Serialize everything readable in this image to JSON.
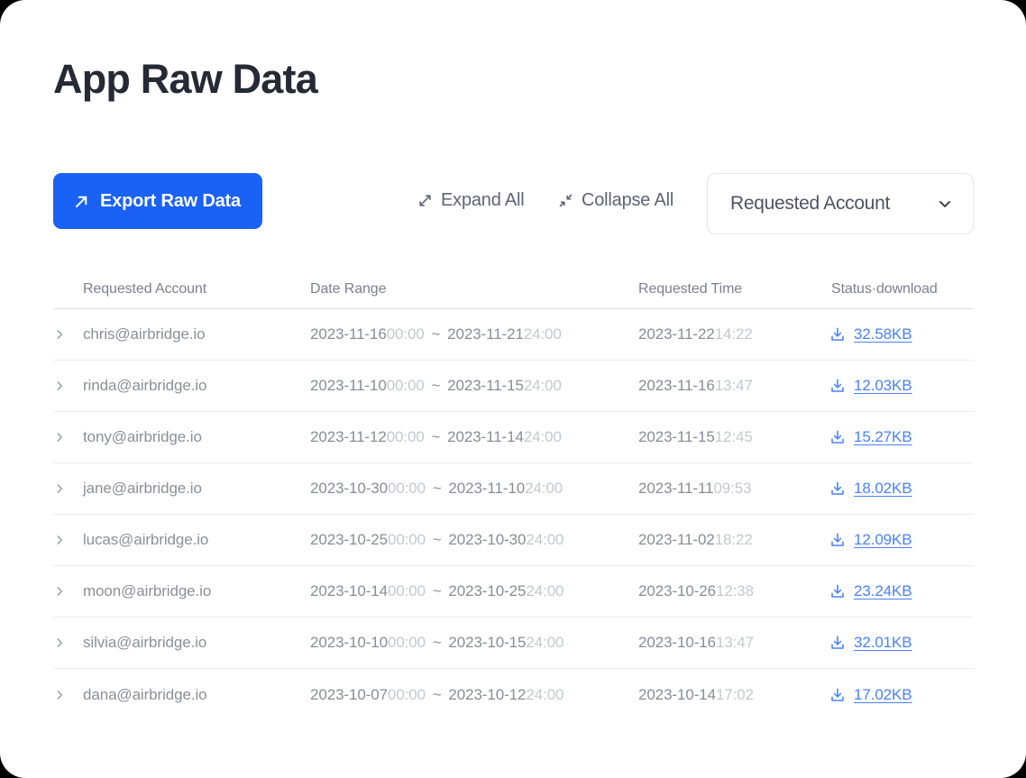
{
  "page": {
    "title": "App Raw Data"
  },
  "toolbar": {
    "export_label": "Export Raw Data",
    "export_icon": "arrow-up-right-icon",
    "expand_all_label": "Expand All",
    "expand_all_icon": "expand-diagonal-icon",
    "collapse_all_label": "Collapse All",
    "collapse_all_icon": "collapse-diagonal-icon",
    "filter_label": "Requested Account",
    "filter_icon": "chevron-down-icon"
  },
  "colors": {
    "accent_blue": "#1a62f5",
    "link_blue": "#4a82f7",
    "title_dark": "#252a34",
    "text_muted": "#8a9099",
    "text_faint": "#c3c8d1",
    "border": "#ebedf1",
    "card_bg": "#ffffff"
  },
  "table": {
    "columns": [
      {
        "key": "account",
        "label": "Requested Account"
      },
      {
        "key": "range",
        "label": "Date Range"
      },
      {
        "key": "time",
        "label": "Requested Time"
      },
      {
        "key": "status",
        "label": "Status·download"
      }
    ],
    "row_expand_icon": "chevron-right-icon",
    "download_icon": "download-icon",
    "range_separator": "~",
    "rows": [
      {
        "account": "chris@airbridge.io",
        "range_start_date": "2023-11-16",
        "range_start_time": "00:00",
        "range_end_date": "2023-11-21",
        "range_end_time": "24:00",
        "requested_date": "2023-11-22",
        "requested_time": "14:22",
        "download_size": "32.58KB"
      },
      {
        "account": "rinda@airbridge.io",
        "range_start_date": "2023-11-10",
        "range_start_time": "00:00",
        "range_end_date": "2023-11-15",
        "range_end_time": "24:00",
        "requested_date": "2023-11-16",
        "requested_time": "13:47",
        "download_size": "12.03KB"
      },
      {
        "account": "tony@airbridge.io",
        "range_start_date": "2023-11-12",
        "range_start_time": "00:00",
        "range_end_date": "2023-11-14",
        "range_end_time": "24:00",
        "requested_date": "2023-11-15",
        "requested_time": "12:45",
        "download_size": "15.27KB"
      },
      {
        "account": "jane@airbridge.io",
        "range_start_date": "2023-10-30",
        "range_start_time": "00:00",
        "range_end_date": "2023-11-10",
        "range_end_time": "24:00",
        "requested_date": "2023-11-11",
        "requested_time": "09:53",
        "download_size": "18.02KB"
      },
      {
        "account": "lucas@airbridge.io",
        "range_start_date": "2023-10-25",
        "range_start_time": "00:00",
        "range_end_date": "2023-10-30",
        "range_end_time": "24:00",
        "requested_date": "2023-11-02",
        "requested_time": "18:22",
        "download_size": "12.09KB"
      },
      {
        "account": "moon@airbridge.io",
        "range_start_date": "2023-10-14",
        "range_start_time": "00:00",
        "range_end_date": "2023-10-25",
        "range_end_time": "24:00",
        "requested_date": "2023-10-26",
        "requested_time": "12:38",
        "download_size": "23.24KB"
      },
      {
        "account": "silvia@airbridge.io",
        "range_start_date": "2023-10-10",
        "range_start_time": "00:00",
        "range_end_date": "2023-10-15",
        "range_end_time": "24:00",
        "requested_date": "2023-10-16",
        "requested_time": "13:47",
        "download_size": "32.01KB"
      },
      {
        "account": "dana@airbridge.io",
        "range_start_date": "2023-10-07",
        "range_start_time": "00:00",
        "range_end_date": "2023-10-12",
        "range_end_time": "24:00",
        "requested_date": "2023-10-14",
        "requested_time": "17:02",
        "download_size": "17.02KB"
      }
    ]
  }
}
